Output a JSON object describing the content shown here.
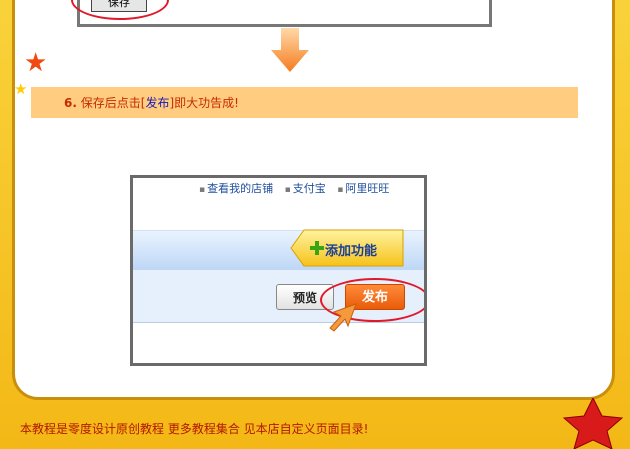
{
  "top_fragment": {
    "save_label": "保存"
  },
  "step": {
    "number": "6.",
    "text_before": "保存后点击[",
    "link": "发布",
    "text_after": "]即大功告成!"
  },
  "shot": {
    "toplinks": [
      "查看我的店铺",
      "支付宝",
      "阿里旺旺"
    ],
    "add_label": "添加功能",
    "preview_label": "预览",
    "publish_label": "发布"
  },
  "footer": {
    "text": "本教程是零度设计原创教程 更多教程集合 见本店自定义页面目录!"
  },
  "colors": {
    "accent_orange": "#f57c1f",
    "highlight_red": "#e0182a",
    "step_bg": "#ffcc80"
  }
}
